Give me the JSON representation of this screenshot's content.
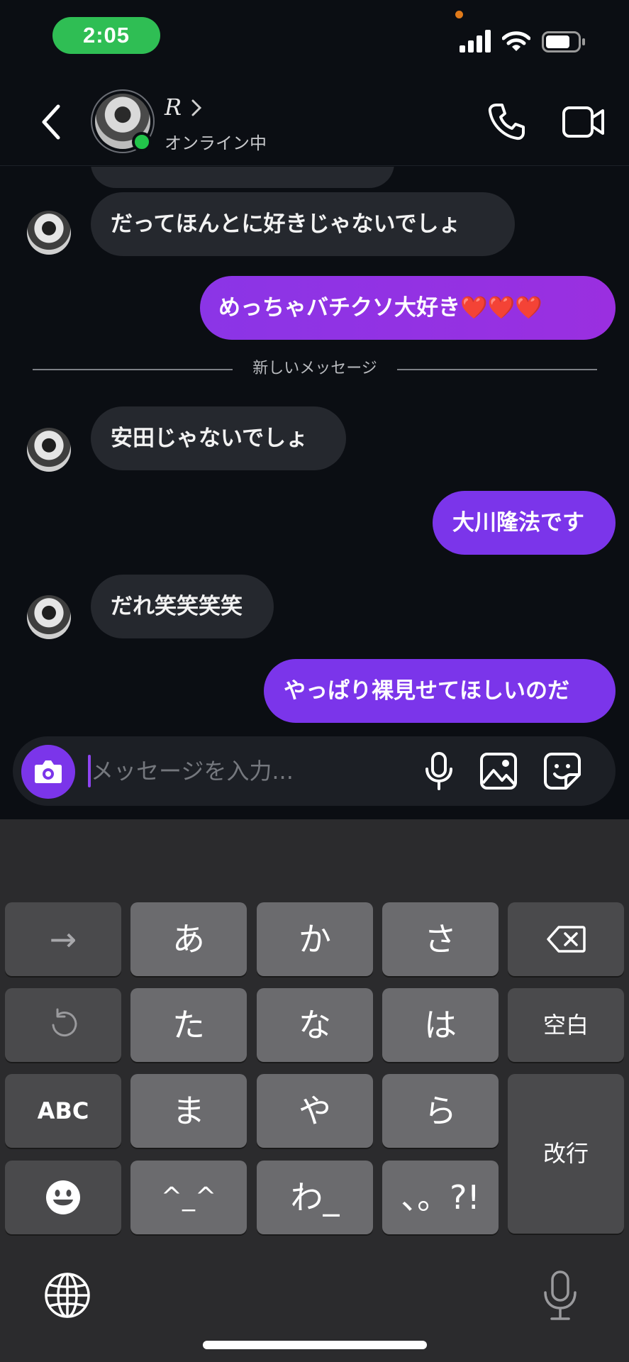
{
  "status_bar": {
    "time": "2:05"
  },
  "header": {
    "contact_name": "R",
    "status": "オンライン中",
    "icons": [
      "back-icon",
      "phone-icon",
      "video-camera-icon"
    ]
  },
  "messages": [
    {
      "side": "in",
      "text": "だってほんとに好きじゃないでしょ"
    },
    {
      "side": "out",
      "text": "めっちゃバチクソ大好き❤️❤️❤️"
    },
    {
      "side": "in",
      "text": "安田じゃないでしょ"
    },
    {
      "side": "out",
      "text": "大川隆法です"
    },
    {
      "side": "in",
      "text": "だれ笑笑笑笑"
    },
    {
      "side": "out",
      "text": "やっぱり裸見せてほしいのだ"
    }
  ],
  "divider_label": "新しいメッセージ",
  "composer": {
    "placeholder": "メッセージを入力...",
    "icons": [
      "camera-icon",
      "microphone-icon",
      "image-icon",
      "sticker-icon"
    ]
  },
  "keyboard": {
    "rows": [
      [
        "→",
        "あ",
        "か",
        "さ",
        "⌫"
      ],
      [
        "↺",
        "た",
        "な",
        "は",
        "空白"
      ],
      [
        "ABC",
        "ま",
        "や",
        "ら",
        "改行"
      ],
      [
        "😀",
        "^_^",
        "わ_",
        "、。?!"
      ]
    ],
    "bottom_icons": [
      "globe-icon",
      "dictation-icon"
    ]
  }
}
